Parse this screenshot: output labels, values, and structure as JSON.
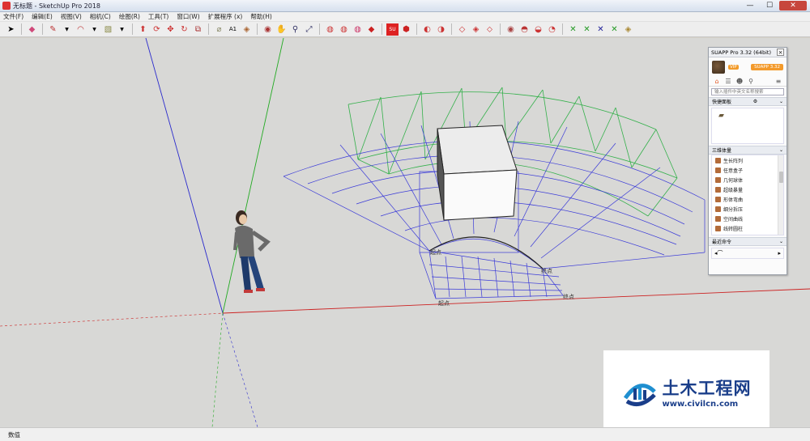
{
  "window": {
    "title": "无标题 - SketchUp Pro 2018",
    "minimize": "—",
    "maximize": "☐",
    "close": "✕"
  },
  "menu": [
    "文件(F)",
    "编辑(E)",
    "视图(V)",
    "相机(C)",
    "绘图(R)",
    "工具(T)",
    "窗口(W)",
    "扩展程序 (x)",
    "帮助(H)"
  ],
  "toolbar_icons": [
    "select-icon",
    "eraser-icon",
    "pencil-icon",
    "arc-icon",
    "rectangle-icon",
    "push-pull-icon",
    "follow-me-icon",
    "move-icon",
    "rotate-icon",
    "scale-icon",
    "tape-measure-icon",
    "text-icon",
    "paint-bucket-icon",
    "orbit-icon",
    "pan-icon",
    "zoom-icon",
    "zoom-extents-icon",
    "warehouse-icon",
    "extension-warehouse-icon",
    "layout-icon",
    "ruby-icon",
    "suapp-icon",
    "component-icon",
    "solid-union-icon",
    "solid-subtract-icon",
    "section-plane-icon",
    "section-display-icon",
    "section-cut-icon",
    "styles-icon",
    "shadow-icon",
    "fog-icon",
    "sandbox-icon",
    "drape-icon",
    "stamp-icon",
    "flip-icon"
  ],
  "viewport": {
    "labels": {
      "start": "起点",
      "end_left": "终点",
      "end_right": "终点",
      "start2": "起点"
    }
  },
  "status": {
    "measure_label": "数值"
  },
  "panel": {
    "title": "SUAPP Pro 3.32 (64bit)",
    "user_badge": "VIP",
    "vip_button": "SUAPP 3.32",
    "search_placeholder": "输入插件中英文名称搜索",
    "quick_panel": "快捷面板",
    "category": "三维体量",
    "items": [
      "生长阵列",
      "任意盒子",
      "几何球体",
      "超级暴量",
      "形体弯曲",
      "细分拆压",
      "空间曲线",
      "线转圆柱"
    ],
    "recent": "最近命令"
  },
  "logo": {
    "cn": "土木工程网",
    "url": "www.civilcn.com"
  },
  "colors": {
    "red_axis": "#cc2222",
    "green_axis": "#22aa22",
    "blue_axis": "#2222cc",
    "grid_blue": "#3a3ad8",
    "box_green": "#33b04a",
    "brand_orange": "#f39a2b",
    "logo_blue": "#1a3e8a"
  }
}
